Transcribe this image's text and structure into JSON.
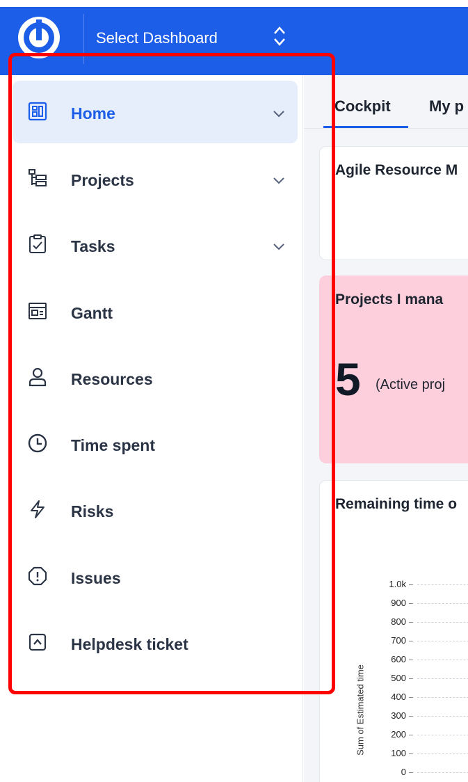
{
  "header": {
    "dashboard_select_label": "Select Dashboard",
    "brand_color": "#1d5ee8"
  },
  "sidebar": {
    "items": [
      {
        "label": "Home",
        "icon": "dashboard-icon",
        "active": true,
        "has_submenu": true
      },
      {
        "label": "Projects",
        "icon": "projects-tree-icon",
        "active": false,
        "has_submenu": true
      },
      {
        "label": "Tasks",
        "icon": "clipboard-check-icon",
        "active": false,
        "has_submenu": true
      },
      {
        "label": "Gantt",
        "icon": "gantt-icon",
        "active": false,
        "has_submenu": false
      },
      {
        "label": "Resources",
        "icon": "person-icon",
        "active": false,
        "has_submenu": false
      },
      {
        "label": "Time spent",
        "icon": "clock-icon",
        "active": false,
        "has_submenu": false
      },
      {
        "label": "Risks",
        "icon": "lightning-icon",
        "active": false,
        "has_submenu": false
      },
      {
        "label": "Issues",
        "icon": "alert-octagon-icon",
        "active": false,
        "has_submenu": false
      },
      {
        "label": "Helpdesk ticket",
        "icon": "ticket-icon",
        "active": false,
        "has_submenu": false
      }
    ]
  },
  "main": {
    "tabs": [
      {
        "label": "Cockpit",
        "active": true
      },
      {
        "label": "My p",
        "active": false
      }
    ],
    "cards": {
      "agile": {
        "title": "Agile Resource M"
      },
      "projects": {
        "title": "Projects I mana",
        "count": "5",
        "caption": "(Active proj"
      },
      "remaining": {
        "title": "Remaining time o"
      }
    },
    "chart": {
      "ylabel": "Sum of Estimated time",
      "ticks": [
        "1.0k",
        "900",
        "800",
        "700",
        "600",
        "500",
        "400",
        "300",
        "200",
        "100",
        "0"
      ]
    }
  },
  "highlight_color": "#ff0000"
}
